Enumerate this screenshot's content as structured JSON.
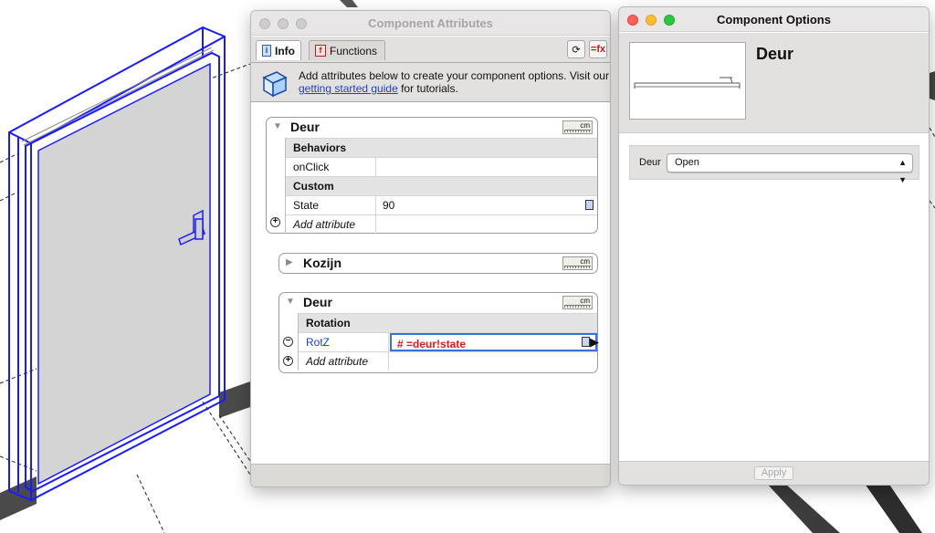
{
  "attributes_window": {
    "title": "Component Attributes",
    "tabs": [
      {
        "label": "Info",
        "icon": "info-icon",
        "active": true
      },
      {
        "label": "Functions",
        "icon": "functions-icon",
        "active": false
      }
    ],
    "info_text_before": "Add attributes below to create your component options. Visit our",
    "info_link": "getting started guide",
    "info_text_after": "for tutorials.",
    "groups": [
      {
        "title": "Deur",
        "expanded": true,
        "units": "cm",
        "rows": [
          {
            "type": "section",
            "label": "Behaviors"
          },
          {
            "type": "attr",
            "name": "onClick",
            "value": ""
          },
          {
            "type": "section",
            "label": "Custom"
          },
          {
            "type": "attr",
            "name": "State",
            "value": "90"
          },
          {
            "type": "add",
            "name": "Add attribute"
          }
        ]
      },
      {
        "title": "Kozijn",
        "expanded": false,
        "units": "cm"
      },
      {
        "title": "Deur",
        "expanded": true,
        "units": "cm",
        "rows": [
          {
            "type": "section",
            "label": "Rotation"
          },
          {
            "type": "attr",
            "name": "RotZ",
            "value": "# =deur!state"
          },
          {
            "type": "add",
            "name": "Add attribute"
          }
        ]
      }
    ]
  },
  "options_window": {
    "title": "Component Options",
    "component_name": "Deur",
    "option_label": "Deur",
    "option_value": "Open",
    "apply_label": "Apply"
  },
  "colors": {
    "selection_blue": "#1a1aff",
    "link_blue": "#1f3fc8",
    "formula_red": "#e01818",
    "window_grey": "#e3e1df"
  }
}
